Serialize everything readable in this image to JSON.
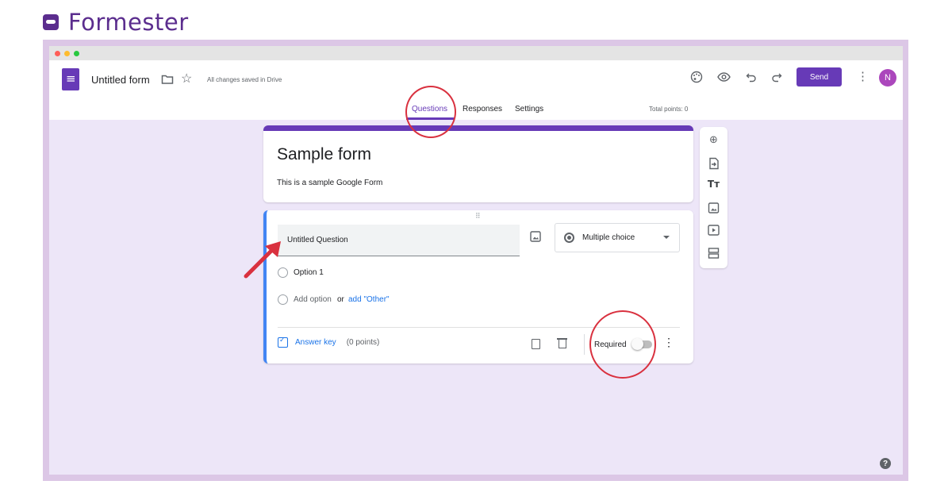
{
  "brand": {
    "name": "Formester"
  },
  "colors": {
    "accent": "#673ab7",
    "link": "#1a73e8",
    "annotation": "#d9313f",
    "frame": "#dcc7e6"
  },
  "window": {
    "traffic_lights": [
      "#ff5f57",
      "#febc2e",
      "#28c840"
    ],
    "app_icon": "forms-icon"
  },
  "header": {
    "doc_title": "Untitled form",
    "saved_status": "All changes saved in Drive",
    "send_label": "Send",
    "avatar_initial": "N",
    "tools": [
      "palette-icon",
      "preview-eye-icon",
      "undo-icon",
      "redo-icon"
    ]
  },
  "tabs": [
    {
      "label": "Questions",
      "active": true
    },
    {
      "label": "Responses",
      "active": false
    },
    {
      "label": "Settings",
      "active": false
    }
  ],
  "total_points": "Total points: 0",
  "form": {
    "title": "Sample form",
    "description": "This is a sample Google Form"
  },
  "question": {
    "title": "Untitled Question",
    "type": "Multiple choice",
    "option1": "Option 1",
    "add_option": "Add option",
    "or_text": "or",
    "add_other": "add \"Other\"",
    "answer_key": "Answer key",
    "points": "(0 points)",
    "required_label": "Required",
    "required": false
  },
  "side_toolbar": [
    "add-question-icon",
    "import-questions-icon",
    "add-title-icon",
    "add-image-icon",
    "add-video-icon",
    "add-section-icon"
  ],
  "help": "?"
}
